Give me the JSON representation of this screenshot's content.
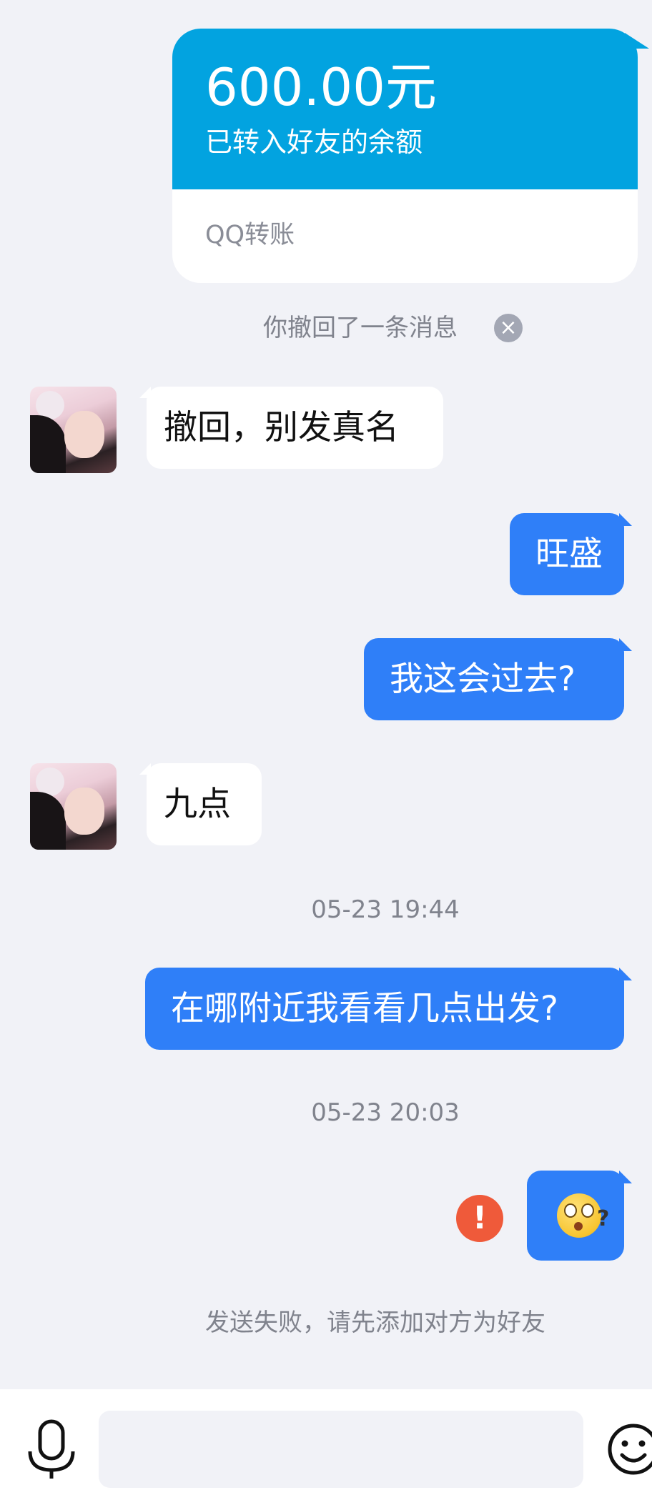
{
  "transfer": {
    "amount": "600.00元",
    "description": "已转入好友的余额",
    "type": "QQ转账"
  },
  "recall_notice": "你撤回了一条消息",
  "messages": [
    {
      "side": "in",
      "text": "撤回，别发真名"
    },
    {
      "side": "out",
      "text": "旺盛"
    },
    {
      "side": "out",
      "text": "我这会过去?"
    },
    {
      "side": "in",
      "text": "九点"
    },
    {
      "side": "out",
      "text": "在哪附近我看看几点出发?"
    },
    {
      "side": "out",
      "type": "emoji",
      "icon": "confused-face-emoji-icon"
    }
  ],
  "timestamps": [
    "05-23 19:44",
    "05-23 20:03"
  ],
  "send_error": "发送失败，请先添加对方为好友",
  "input": {
    "placeholder": ""
  },
  "colors": {
    "transfer_blue": "#02a3e0",
    "outgoing_bubble": "#2f7ff8",
    "error_red": "#ef5a3a",
    "background": "#f1f2f7"
  }
}
